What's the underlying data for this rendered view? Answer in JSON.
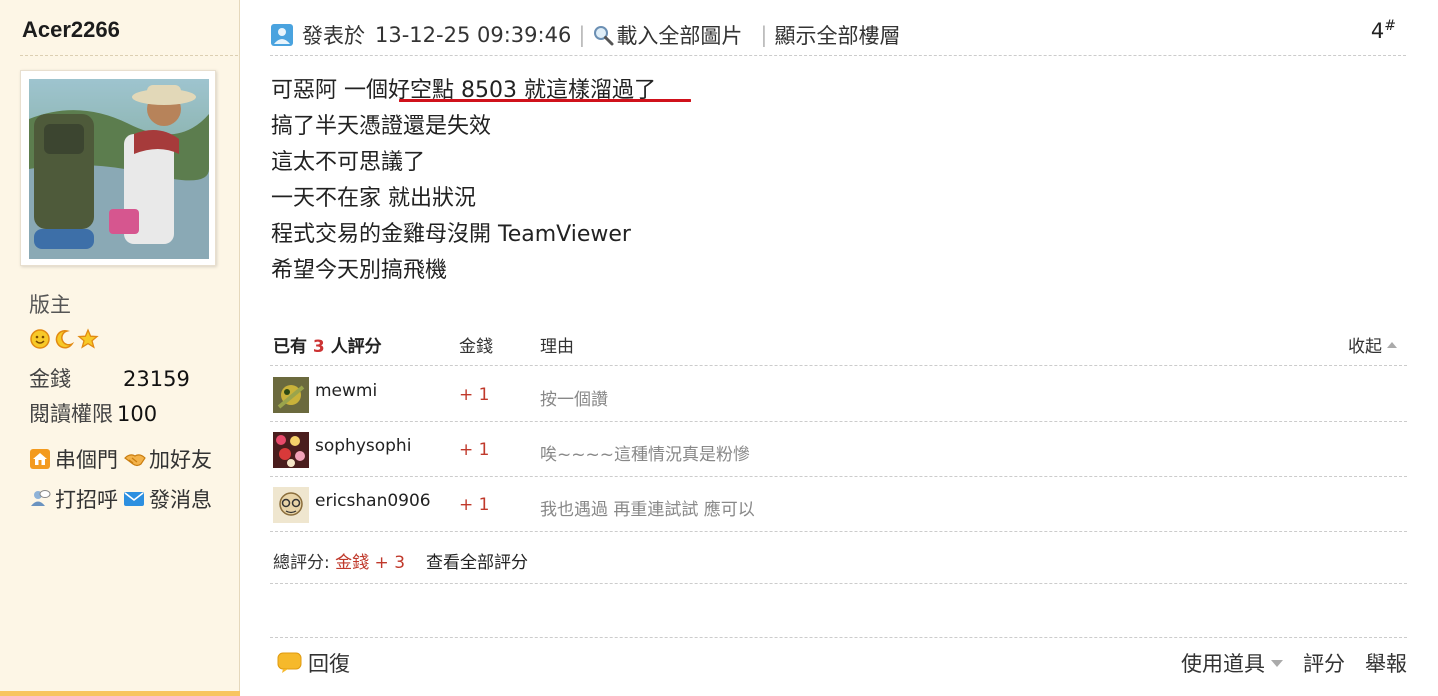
{
  "sidebar": {
    "username": "Acer2266",
    "rank": "版主",
    "rank_icon_names": [
      "smile-icon",
      "moon-icon",
      "star-icon"
    ],
    "money_label": "金錢",
    "money_value": "23159",
    "read_label": "閱讀權限",
    "read_value": "100",
    "actions": {
      "visit": "串個門",
      "add_friend": "加好友",
      "greet": "打招呼",
      "message": "發消息"
    }
  },
  "post": {
    "posted_label": "發表於",
    "posted_time": "13-12-25 09:39:46",
    "load_images": "載入全部圖片",
    "show_floors": "顯示全部樓層",
    "floor": "4",
    "floor_mark": "#",
    "lines": [
      "可惡阿 一個好空點 8503 就這樣溜過了",
      "搞了半天憑證還是失效",
      "這太不可思議了",
      "一天不在家 就出狀況",
      "程式交易的金雞母沒開 TeamViewer",
      "希望今天別搞飛機"
    ]
  },
  "rating": {
    "header_prefix": "已有",
    "count": "3",
    "header_suffix": "人評分",
    "col_money": "金錢",
    "col_reason": "理由",
    "collapse": "收起",
    "rows": [
      {
        "user": "mewmi",
        "points": "+ 1",
        "reason": "按一個讚"
      },
      {
        "user": "sophysophi",
        "points": "+ 1",
        "reason": "唉~~~~這種情況真是粉慘"
      },
      {
        "user": "ericshan0906",
        "points": "+ 1",
        "reason": "我也遇過 再重連試試 應可以"
      }
    ],
    "total_label": "總評分:",
    "total_money": "金錢",
    "total_value": "+ 3",
    "view_all": "查看全部評分"
  },
  "footer": {
    "reply": "回復",
    "tools": "使用道具",
    "rate": "評分",
    "report": "舉報"
  },
  "colors": {
    "sidebar_bg": "#fdf6e6",
    "accent_red": "#c0392b",
    "underline_red": "#d0111b",
    "bottom_bar": "#f8c560"
  }
}
